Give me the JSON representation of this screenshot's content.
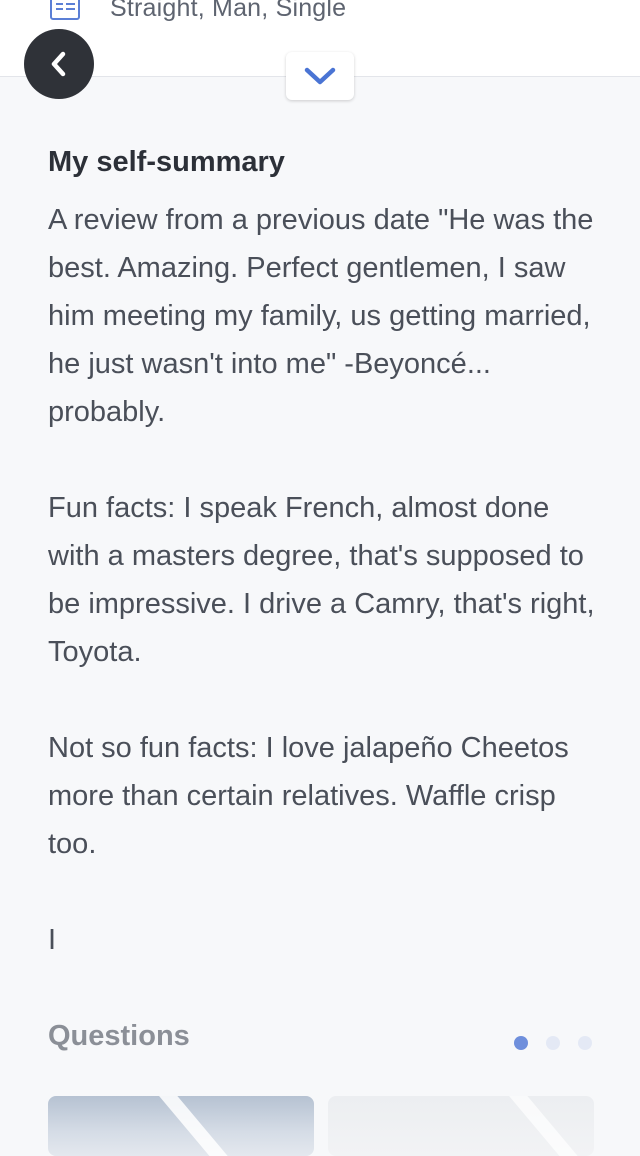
{
  "header": {
    "details_text": "Straight, Man, Single",
    "details_icon": "id-card-icon",
    "back_icon": "chevron-left-icon",
    "expand_icon": "chevron-down-icon"
  },
  "self_summary": {
    "title": "My self-summary",
    "paragraphs": [
      "A review from a previous date \"He was the best. Amazing. Perfect gentlemen, I saw him meeting my family, us getting married, he just wasn't into me\" -Beyoncé... probably.",
      "Fun facts: I speak French, almost done with a masters degree, that's supposed to be impressive. I drive a Camry, that's right, Toyota.",
      "Not so fun facts: I love jalapeño Cheetos more than certain relatives. Waffle crisp too.",
      "I"
    ]
  },
  "questions": {
    "title": "Questions",
    "page_count": 3,
    "active_page": 1
  },
  "colors": {
    "accent": "#5b7fd6",
    "back_button_bg": "#2f3238",
    "dot_active": "#6f8fdc",
    "dot_inactive": "#e4e9f5",
    "background": "#f7f8fa"
  }
}
